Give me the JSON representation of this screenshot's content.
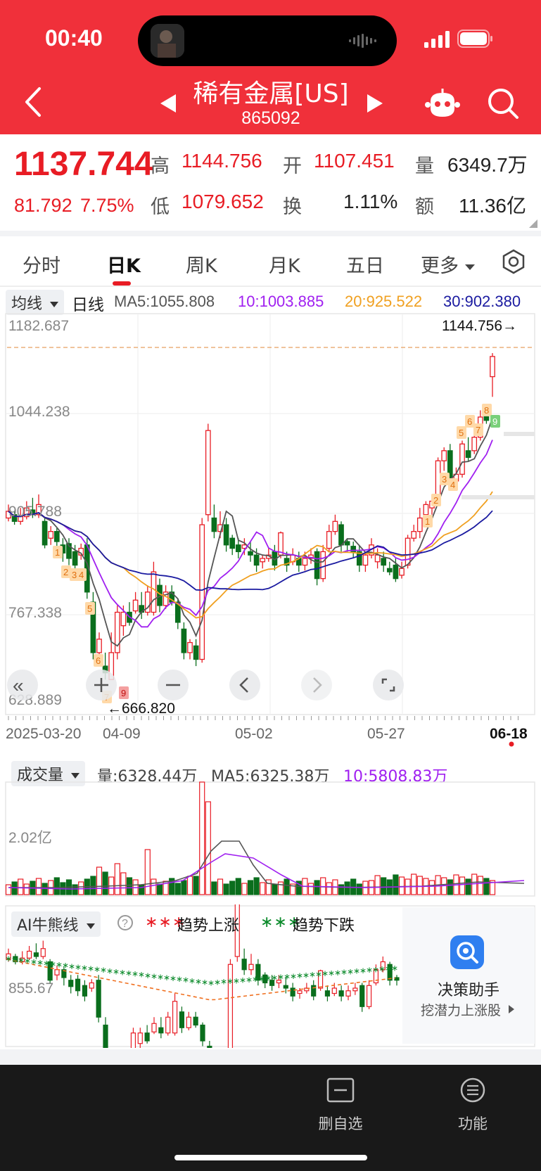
{
  "status_bar": {
    "time": "00:40"
  },
  "header": {
    "stock_name": "稀有金属[US]",
    "stock_code": "865092"
  },
  "quote": {
    "price": "1137.744",
    "change": "81.792",
    "change_pct": "7.75%",
    "high_label": "高",
    "high": "1144.756",
    "low_label": "低",
    "low": "1079.652",
    "open_label": "开",
    "open": "1107.451",
    "turnover_label": "换",
    "turnover": "1.11%",
    "volume_label": "量",
    "volume": "6349.7万",
    "amount_label": "额",
    "amount": "11.36亿"
  },
  "tabs": [
    {
      "label": "分时"
    },
    {
      "label": "日K"
    },
    {
      "label": "周K"
    },
    {
      "label": "月K"
    },
    {
      "label": "五日"
    },
    {
      "label": "更多"
    }
  ],
  "indicator": {
    "ma_selector": "均线",
    "period": "日线",
    "ma5": "MA5:1055.808",
    "ma10": "10:1003.885",
    "ma20": "20:925.522",
    "ma30": "30:902.380"
  },
  "kchart": {
    "y_labels": [
      "1182.687",
      "1044.238",
      "905.788",
      "767.338",
      "628.889"
    ],
    "max_marker": "1144.756→",
    "min_marker": "←666.820",
    "x_labels": [
      "2025-03-20",
      "04-09",
      "05-02",
      "05-27",
      "06-18"
    ]
  },
  "volume_panel": {
    "selector": "成交量",
    "vol": "量:6328.44万",
    "ma5": "MA5:6325.38万",
    "ma10": "10:5808.83万",
    "y_label": "2.02亿"
  },
  "ai_panel": {
    "selector": "AI牛熊线",
    "up_label": "趋势上涨",
    "down_label": "趋势下跌",
    "y_label": "855.67",
    "assistant_title": "决策助手",
    "assistant_sub": "挖潜力上涨股"
  },
  "bottom_nav": {
    "watchlist_delete": "删自选",
    "functions": "功能"
  },
  "colors": {
    "up": "#e81c24",
    "down": "#0a6e1d",
    "header": "#f0303a",
    "ma5": "#555555",
    "ma10": "#a020f0",
    "ma20": "#f0a020",
    "ma30": "#1a1aa0"
  }
}
